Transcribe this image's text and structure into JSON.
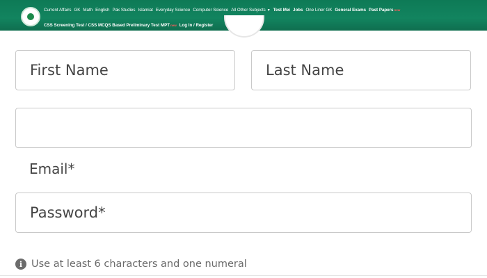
{
  "nav": {
    "row1": [
      {
        "label": "Current Affairs",
        "bold": false
      },
      {
        "label": "GK",
        "bold": false
      },
      {
        "label": "Math",
        "bold": false
      },
      {
        "label": "English",
        "bold": false
      },
      {
        "label": "Pak Studies",
        "bold": false
      },
      {
        "label": "Islamiat",
        "bold": false
      },
      {
        "label": "Everyday Science",
        "bold": false
      },
      {
        "label": "Computer Science",
        "bold": false
      },
      {
        "label": "All Other Subjects",
        "bold": false,
        "dropdown": true
      },
      {
        "label": "Test Mei",
        "bold": true
      },
      {
        "label": "Jobs",
        "bold": true
      },
      {
        "label": "One Liner GK",
        "bold": false
      },
      {
        "label": "General Exams",
        "bold": true
      },
      {
        "label": "Past Papers",
        "bold": true,
        "badge": "new"
      }
    ],
    "row2": [
      {
        "label": "CSS Screening Test / CSS MCQS Based Preliminary Test MPT",
        "bold": true,
        "badge": "new"
      },
      {
        "label": "Log In / Register",
        "bold": true
      }
    ]
  },
  "form": {
    "first_name_placeholder": "First Name",
    "last_name_placeholder": "Last Name",
    "blank_field_value": "",
    "email_label": "Email*",
    "password_placeholder": "Password*",
    "hint": "Use at least 6 characters and one numeral"
  },
  "icons": {
    "logo": "site-logo",
    "dropdown": "caret-down-icon",
    "info": "info-icon"
  },
  "colors": {
    "header_green": "#12845f",
    "border_gray": "#c9c9c9",
    "badge_red": "#ff5b5b"
  }
}
